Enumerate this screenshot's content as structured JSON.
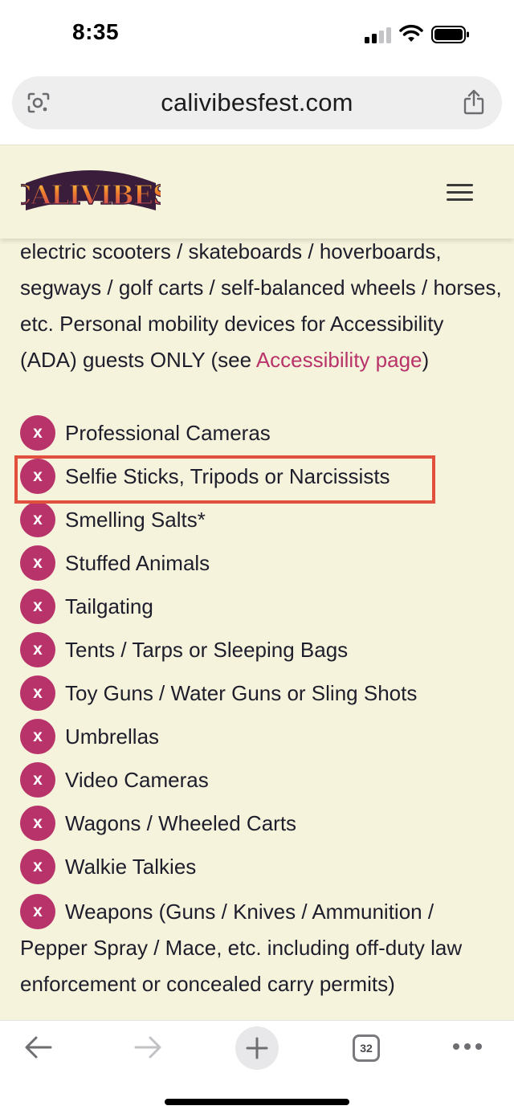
{
  "status_bar": {
    "time": "8:35"
  },
  "browser": {
    "url": "calivibesfest.com",
    "tab_count": "32"
  },
  "site": {
    "logo_text": "CALIVIBES"
  },
  "content": {
    "intro_text": "electric scooters / skateboards / hoverboards, segways / golf carts / self-balanced wheels / horses, etc. Personal mobility devices for Accessibility (ADA) guests ONLY (see ",
    "intro_link": "Accessibility page",
    "intro_close": ")",
    "badge_label": "x",
    "items": [
      "Professional Cameras",
      "Selfie Sticks, Tripods or Narcissists",
      "Smelling Salts*",
      "Stuffed Animals",
      "Tailgating",
      "Tents / Tarps or Sleeping Bags",
      "Toy Guns / Water Guns or Sling Shots",
      "Umbrellas",
      "Video Cameras",
      "Wagons / Wheeled Carts",
      "Walkie Talkies"
    ],
    "last_item": "Weapons (Guns / Knives / Ammunition / Pepper Spray / Mace, etc. including off-duty law enforcement or concealed carry permits)"
  },
  "colors": {
    "page_background": "#f6f3dc",
    "accent_magenta": "#b8336a",
    "highlight_red": "#e0503c"
  },
  "icons": {
    "toolbar": [
      "back-arrow-icon",
      "forward-arrow-icon",
      "plus-icon",
      "tabs-icon",
      "more-icon"
    ],
    "url_bar": [
      "lens-icon",
      "share-icon"
    ]
  }
}
